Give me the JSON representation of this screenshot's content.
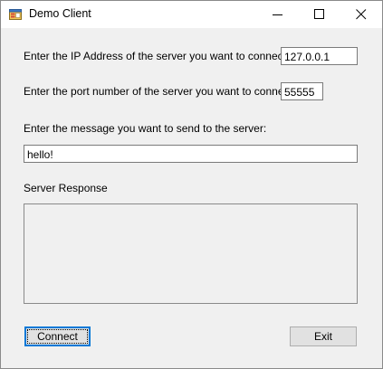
{
  "window": {
    "title": "Demo Client",
    "icon": "app-form-icon",
    "caption_buttons": [
      "minimize-icon",
      "maximize-icon",
      "close-icon"
    ]
  },
  "form": {
    "ip_label": "Enter the IP Address of the server you want to connect to:",
    "ip_value": "127.0.0.1",
    "port_label": "Enter the port number of the server you want to connect to:",
    "port_value": "55555",
    "message_label": "Enter the message you want to send to the server:",
    "message_value": "hello!",
    "response_label": "Server Response",
    "response_value": ""
  },
  "buttons": {
    "connect_label": "Connect",
    "exit_label": "Exit"
  },
  "colors": {
    "window_bg": "#f0f0f0",
    "titlebar_bg": "#ffffff",
    "focus_accent": "#0078d7"
  }
}
